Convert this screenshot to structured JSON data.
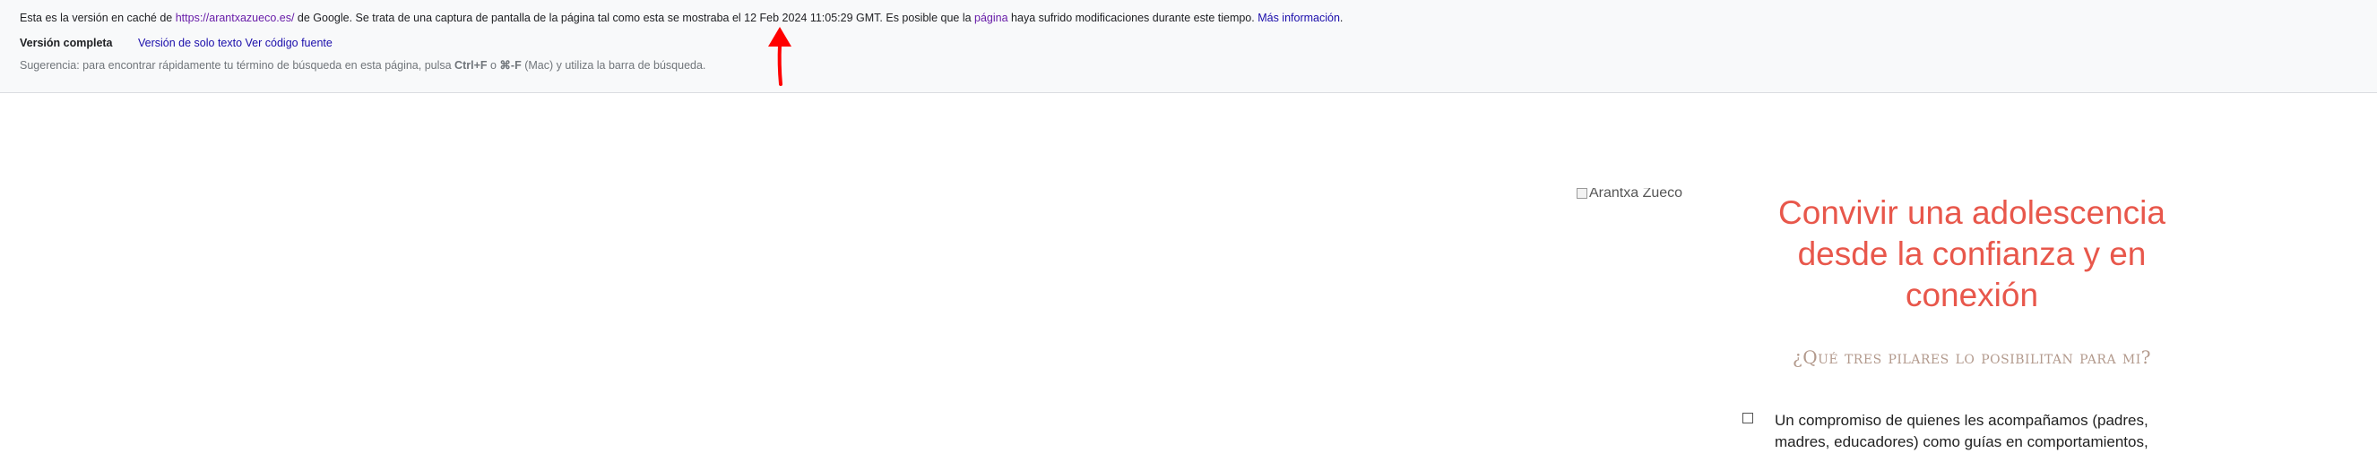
{
  "cache_notice": {
    "line1_before_url": "Esta es la versión en caché de ",
    "url": "https://arantxazueco.es/",
    "line1_after_url": " de Google. Se trata de una captura de pantalla de la página tal como esta se mostraba el 12 Feb 2024 11:05:29 GMT. Es posible que la ",
    "page_link": "página",
    "line1_after_page": " haya sufrido modificaciones durante este tiempo. ",
    "more_info_link": "Más información",
    "line1_end": ".",
    "full_version": "Versión completa",
    "text_only_version": "Versión de solo texto",
    "view_source": "Ver código fuente",
    "tip_before": "Sugerencia: para encontrar rápidamente tu término de búsqueda en esta página, pulsa ",
    "tip_key1": "Ctrl+F",
    "tip_middle": " o ",
    "tip_key2": "⌘-F",
    "tip_after": " (Mac) y utiliza la barra de búsqueda."
  },
  "annotation": {
    "arrow_color": "#ff0000",
    "icon": "arrow-up-icon"
  },
  "site": {
    "logo_alt": "Arantxa Zueco",
    "hero_title": "Convivir una adolescencia desde la confianza y en conexión",
    "subtitle": "¿Qué tres pilares lo posibilitan para mi?",
    "bullet_1": "Un compromiso de quienes les acompañamos (padres, madres, educadores) como guías en comportamientos,",
    "title_color": "#e8574b",
    "subtitle_color": "#b39a8d"
  }
}
